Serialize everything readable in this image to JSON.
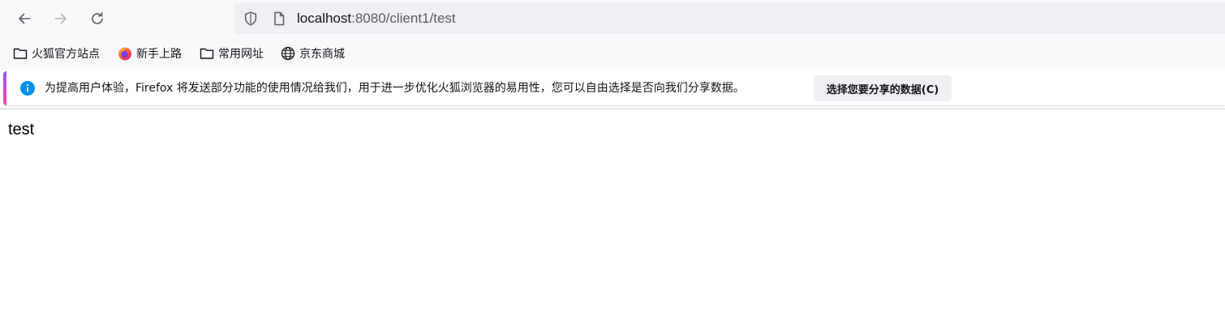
{
  "toolbar": {
    "back_icon": "arrow-left-icon",
    "forward_icon": "arrow-right-icon",
    "reload_icon": "reload-icon"
  },
  "urlbar": {
    "host": "localhost",
    "path": ":8080/client1/test",
    "shield_icon": "shield-icon",
    "page_icon": "page-icon"
  },
  "bookmarks": [
    {
      "label": "火狐官方站点",
      "icon": "folder-icon"
    },
    {
      "label": "新手上路",
      "icon": "firefox-icon"
    },
    {
      "label": "常用网址",
      "icon": "folder-icon"
    },
    {
      "label": "京东商城",
      "icon": "globe-icon"
    }
  ],
  "notification": {
    "message": "为提高用户体验，Firefox 将发送部分功能的使用情况给我们，用于进一步优化火狐浏览器的易用性，您可以自由选择是否向我们分享数据。",
    "button_label": "选择您要分享的数据(C)",
    "icon": "info-icon",
    "accent_colors": [
      "#9059ff",
      "#ff4aa2"
    ],
    "info_color": "#0090ed"
  },
  "page": {
    "body_text": "test"
  }
}
